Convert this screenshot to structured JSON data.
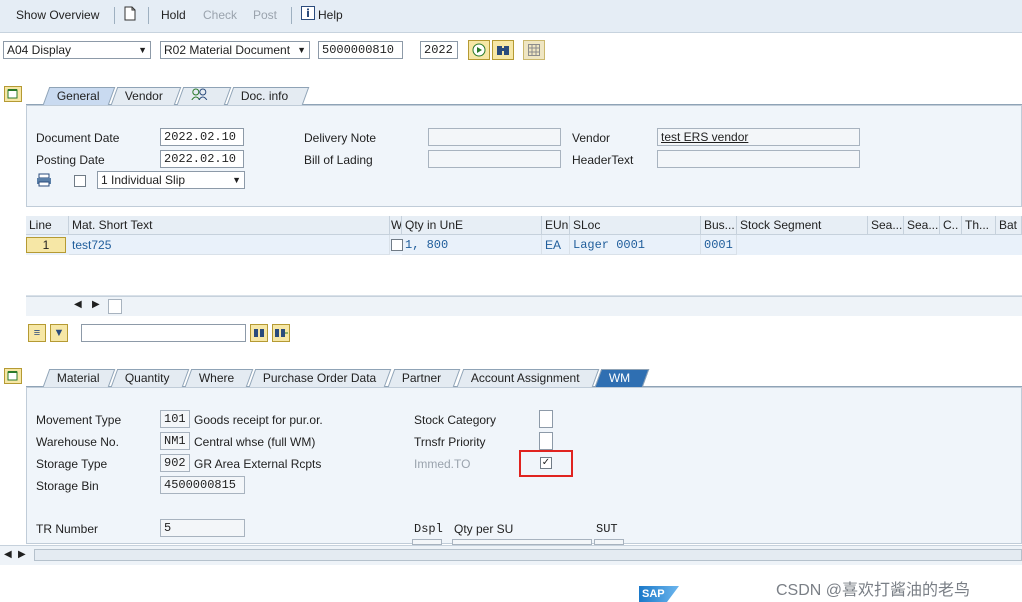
{
  "toolbar": {
    "show_overview": "Show Overview",
    "hold": "Hold",
    "check": "Check",
    "post": "Post",
    "help": "Help"
  },
  "selection": {
    "action": "A04 Display",
    "ref_doc_type": "R02 Material Document",
    "doc_number": "5000000810",
    "year": "2022"
  },
  "header_tabs": [
    "General",
    "Vendor",
    "",
    "Doc. info"
  ],
  "general": {
    "doc_date_label": "Document Date",
    "doc_date": "2022.02.10",
    "posting_date_label": "Posting Date",
    "posting_date": "2022.02.10",
    "delivery_note_label": "Delivery Note",
    "bill_of_lading_label": "Bill of Lading",
    "vendor_label": "Vendor",
    "vendor_value": "test ERS vendor",
    "header_text_label": "HeaderText",
    "slip_option": "1 Individual Slip"
  },
  "items_table": {
    "headers": [
      "Line",
      "Mat. Short Text",
      "W",
      "Qty in UnE",
      "EUn",
      "SLoc",
      "Bus...",
      "Stock Segment",
      "Sea...",
      "Sea...",
      "C..",
      "Th...",
      "Bat"
    ],
    "rows": [
      {
        "line": "1",
        "text": "test725",
        "qty": "1, 800",
        "eun": "EA",
        "sloc": "Lager 0001",
        "bus": "0001"
      }
    ]
  },
  "detail_tabs": [
    "Material",
    "Quantity",
    "Where",
    "Purchase Order Data",
    "Partner",
    "Account Assignment",
    "WM"
  ],
  "wm": {
    "movement_type_label": "Movement Type",
    "movement_type": "101",
    "movement_type_text": "Goods receipt for pur.or.",
    "warehouse_label": "Warehouse No.",
    "warehouse": "NM1",
    "warehouse_text": "Central whse (full WM)",
    "storage_type_label": "Storage Type",
    "storage_type": "902",
    "storage_type_text": "GR Area External Rcpts",
    "storage_bin_label": "Storage Bin",
    "storage_bin": "4500000815",
    "tr_number_label": "TR Number",
    "tr_number": "5",
    "stock_category_label": "Stock Category",
    "transfer_priority_label": "Trnsfr Priority",
    "immed_to_label": "Immed.TO",
    "immed_to_checked": true,
    "dspl_label": "Dspl",
    "qty_per_su_label": "Qty per SU",
    "sut_label": "SUT"
  },
  "footer": {
    "sap_logo": "SAP",
    "watermark": "CSDN @喜欢打酱油的老鸟"
  },
  "colors": {
    "highlight_box": "#e0231f",
    "toolbar_bg": "#e5edf5",
    "panel_bg": "#f0f5fa"
  }
}
